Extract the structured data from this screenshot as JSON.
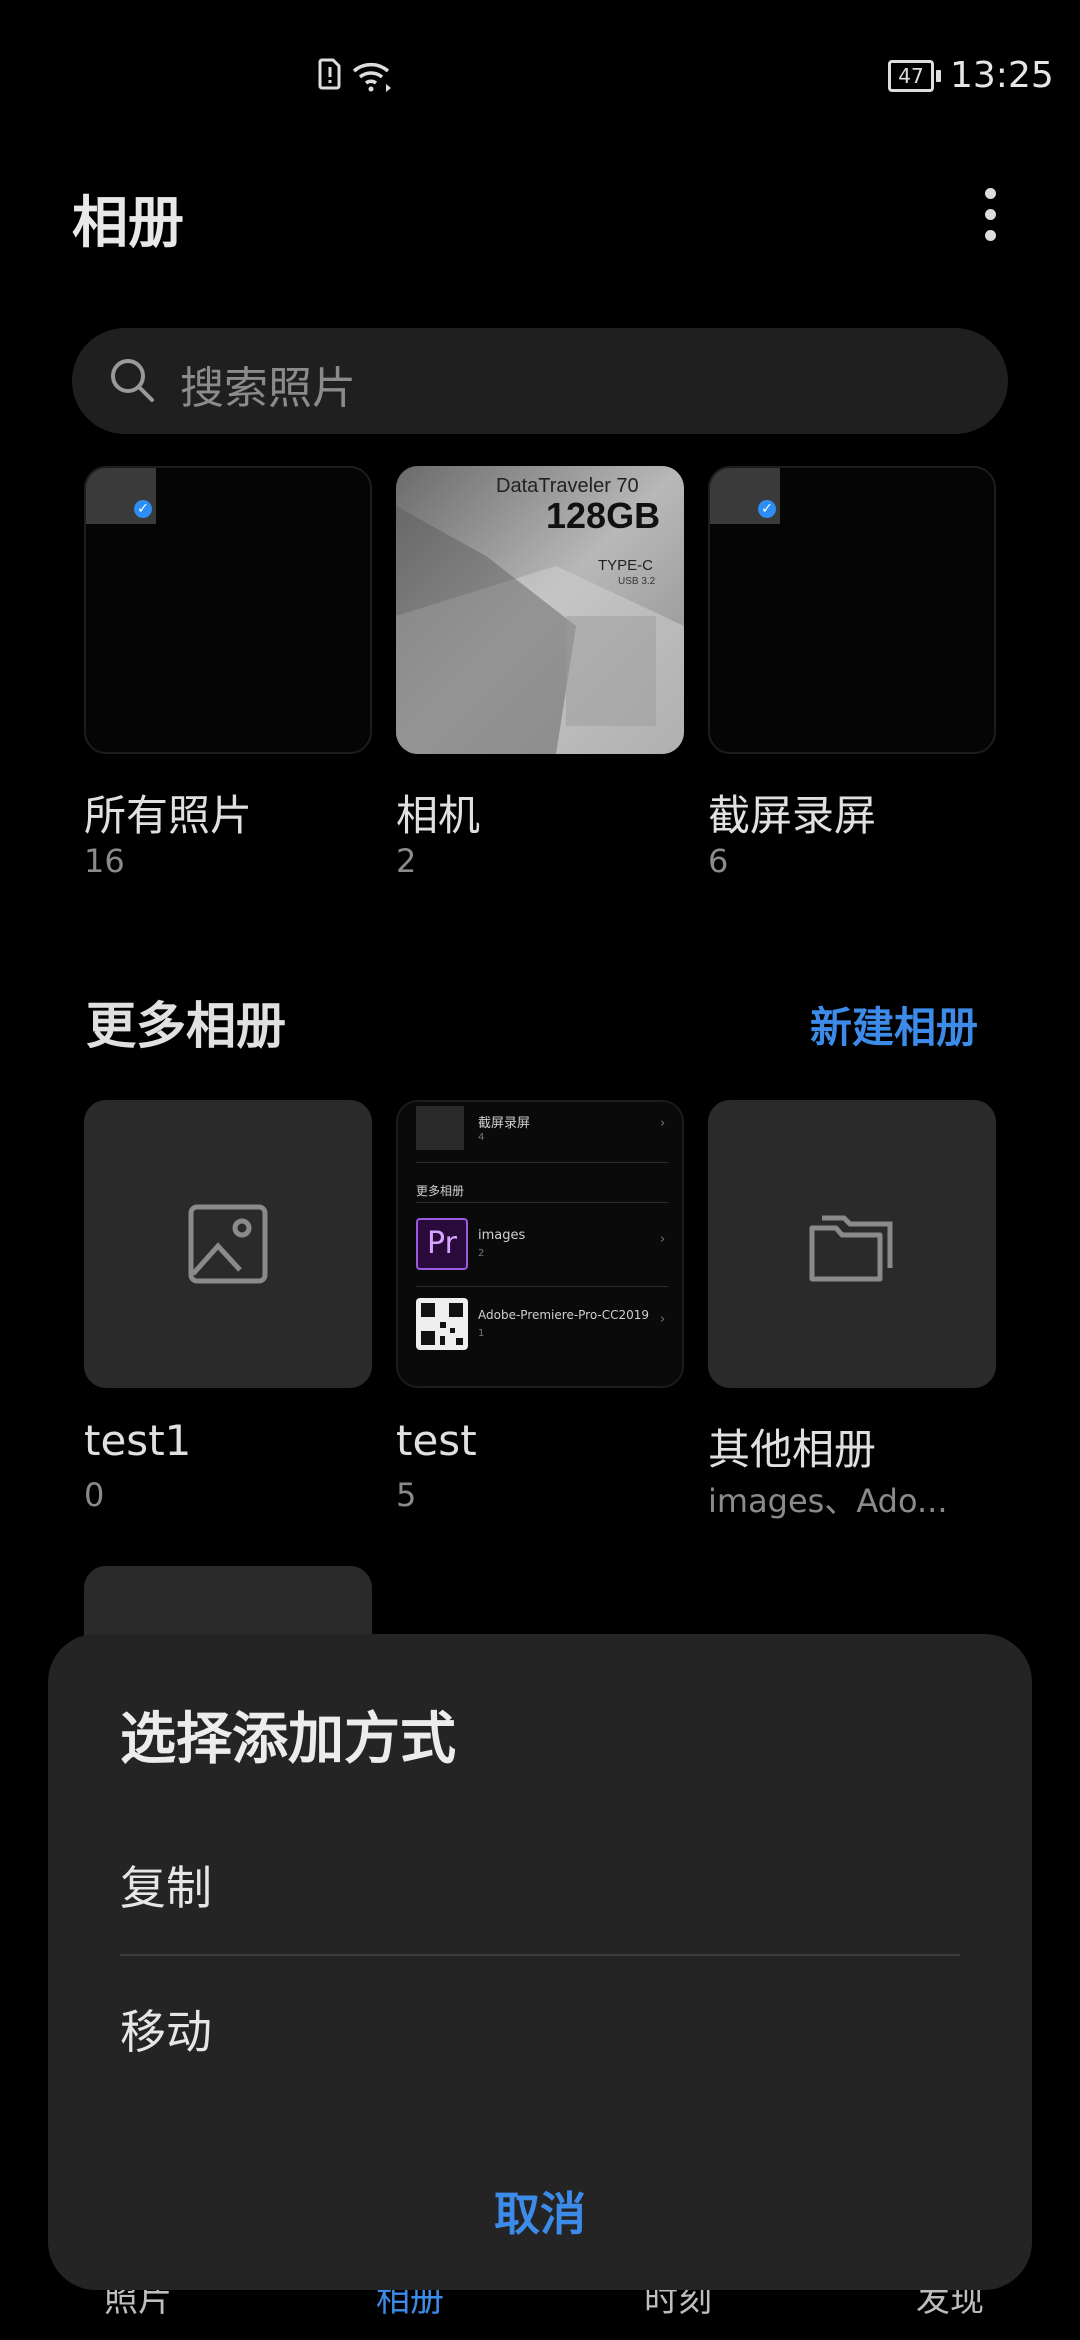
{
  "status_bar": {
    "battery": "47",
    "time": "13:25"
  },
  "header": {
    "title": "相册"
  },
  "search": {
    "placeholder": "搜索照片"
  },
  "top_albums": [
    {
      "name": "所有照片",
      "count": "16"
    },
    {
      "name": "相机",
      "count": "2"
    },
    {
      "name": "截屏录屏",
      "count": "6"
    }
  ],
  "camera_thumb": {
    "brand": "DataTraveler 70",
    "capacity": "128GB",
    "type": "TYPE-C",
    "usb": "USB 3.2"
  },
  "more_albums": {
    "title": "更多相册",
    "new_album_label": "新建相册",
    "items": [
      {
        "name": "test1",
        "count": "0"
      },
      {
        "name": "test",
        "count": "5"
      },
      {
        "name": "其他相册",
        "count": "images、Ado..."
      }
    ]
  },
  "test_preview": {
    "row1_name": "截屏录屏",
    "row1_count": "4",
    "section": "更多相册",
    "row2_name": "images",
    "row2_count": "2",
    "row2_icon": "Pr",
    "row3_name": "Adobe-Premiere-Pro-CC2019",
    "row3_count": "1"
  },
  "dialog": {
    "title": "选择添加方式",
    "options": [
      "复制",
      "移动"
    ],
    "cancel_label": "取消"
  },
  "bottom_nav": [
    "照片",
    "相册",
    "时刻",
    "发现"
  ],
  "colors": {
    "accent": "#3d8be8",
    "background": "#000000",
    "dialog": "#242424"
  }
}
